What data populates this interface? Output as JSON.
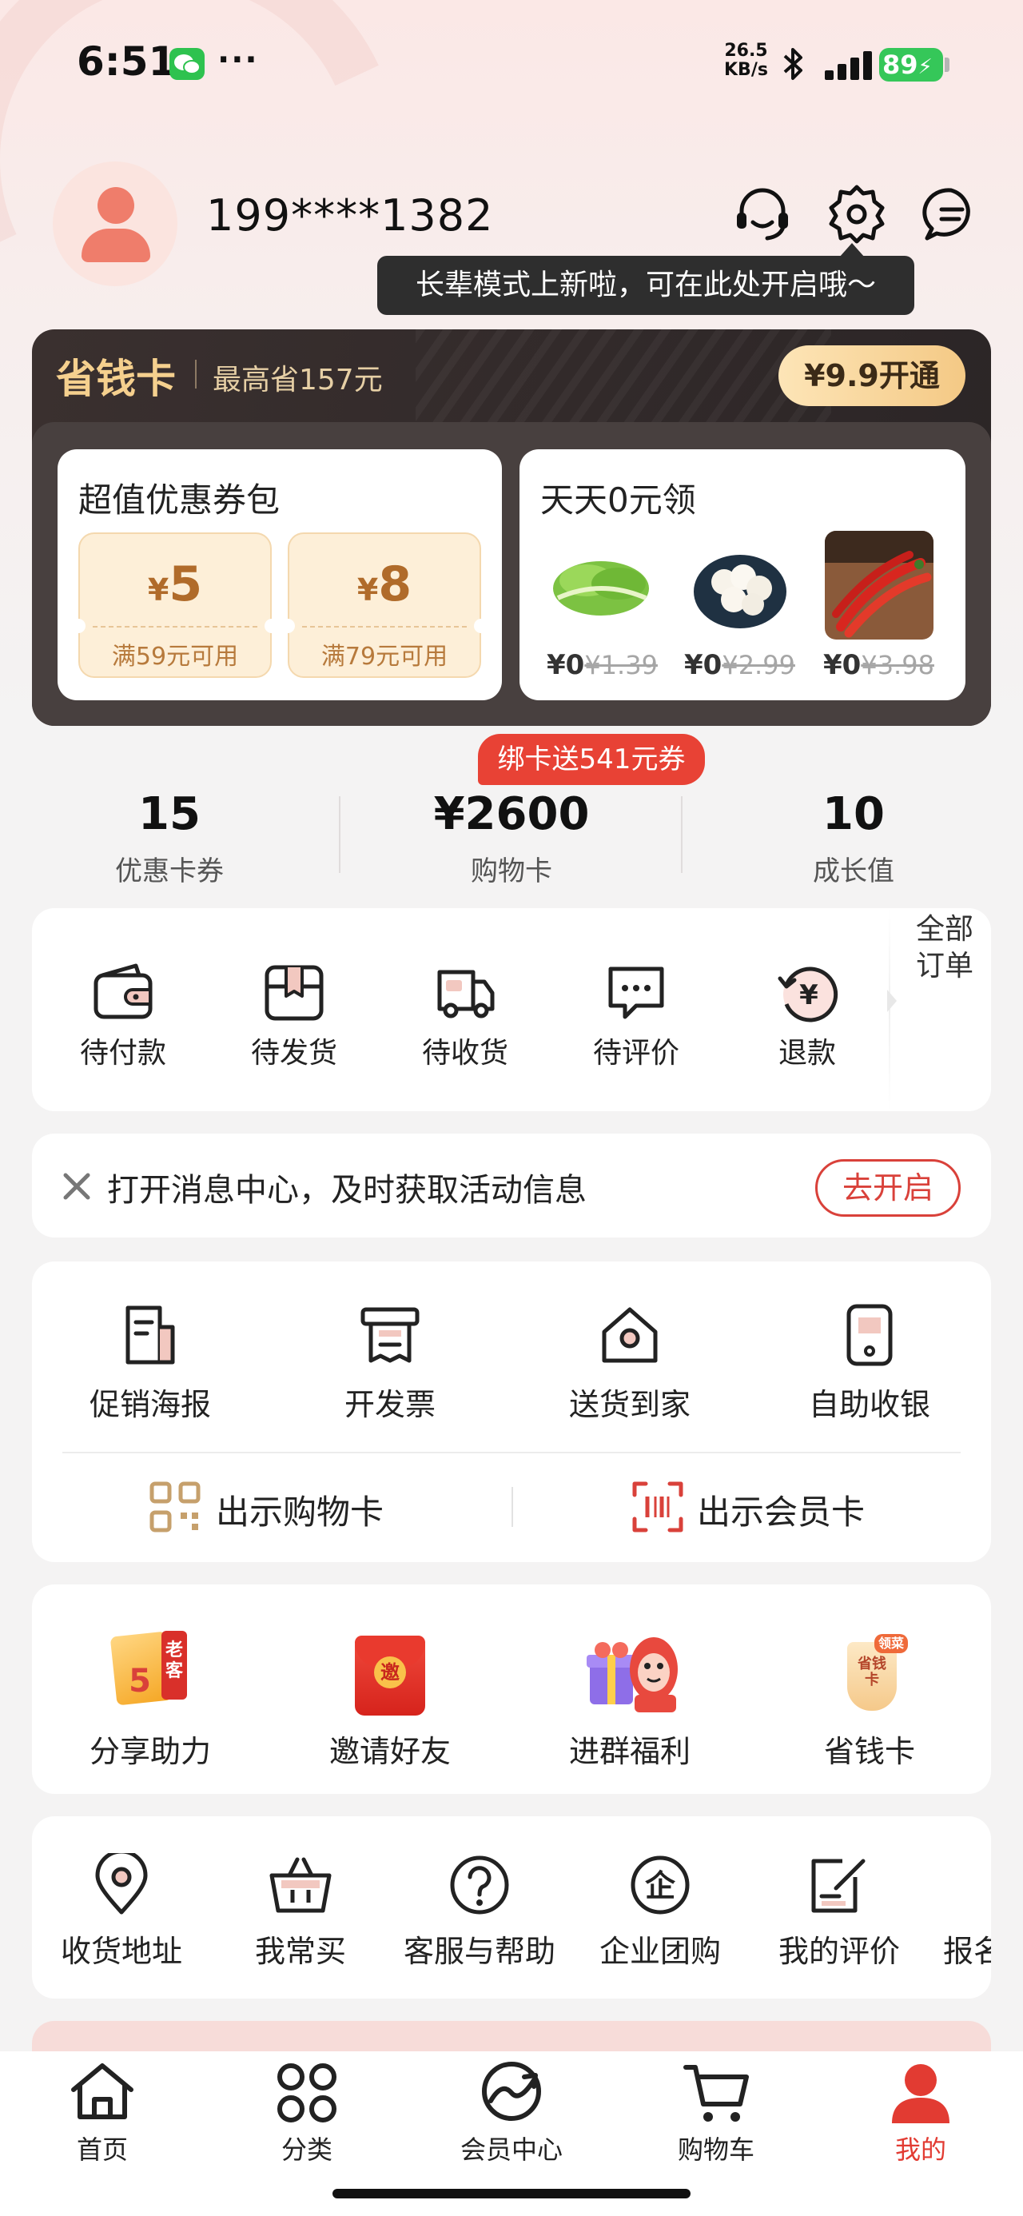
{
  "status_bar": {
    "time": "6:51",
    "dots": "···",
    "net_speed_value": "26.5",
    "net_speed_unit": "KB/s",
    "battery": "89"
  },
  "profile": {
    "phone": "199****1382",
    "tooltip": "长辈模式上新啦，可在此处开启哦～"
  },
  "savings_card": {
    "title": "省钱卡",
    "subtitle": "最高省157元",
    "open_button": "¥9.9开通",
    "coupon_pack": {
      "title": "超值优惠券包",
      "coupons": [
        {
          "symbol": "¥",
          "amount": "5",
          "condition": "满59元可用"
        },
        {
          "symbol": "¥",
          "amount": "8",
          "condition": "满79元可用"
        }
      ]
    },
    "daily_free": {
      "title": "天天0元领",
      "items": [
        {
          "price": "¥0",
          "original": "¥1.39",
          "image": "lettuce"
        },
        {
          "price": "¥0",
          "original": "¥2.99",
          "image": "garlic"
        },
        {
          "price": "¥0",
          "original": "¥3.98",
          "image": "chili-peppers"
        }
      ]
    }
  },
  "stats": {
    "promo_badge": "绑卡送541元券",
    "items": [
      {
        "value": "15",
        "label": "优惠卡券"
      },
      {
        "value": "¥2600",
        "label": "购物卡"
      },
      {
        "value": "10",
        "label": "成长值"
      }
    ]
  },
  "orders": {
    "items": [
      {
        "label": "待付款",
        "icon": "wallet-icon"
      },
      {
        "label": "待发货",
        "icon": "box-icon"
      },
      {
        "label": "待收货",
        "icon": "truck-icon"
      },
      {
        "label": "待评价",
        "icon": "chat-icon"
      },
      {
        "label": "退款",
        "icon": "refund-icon"
      }
    ],
    "all_orders": "全部订单"
  },
  "notice": {
    "text": "打开消息中心，及时获取活动信息",
    "button": "去开启"
  },
  "tools": {
    "items": [
      {
        "label": "促销海报",
        "icon": "poster-icon"
      },
      {
        "label": "开发票",
        "icon": "invoice-icon"
      },
      {
        "label": "送货到家",
        "icon": "home-delivery-icon"
      },
      {
        "label": "自助收银",
        "icon": "self-checkout-icon"
      }
    ],
    "show_shopping_card": "出示购物卡",
    "show_member_card": "出示会员卡"
  },
  "promos": {
    "items": [
      {
        "label": "分享助力",
        "icon": "share-boost-icon"
      },
      {
        "label": "邀请好友",
        "icon": "invite-envelope-icon"
      },
      {
        "label": "进群福利",
        "icon": "group-gift-icon"
      },
      {
        "label": "省钱卡",
        "icon": "savings-card-icon"
      }
    ],
    "share_badge_text": "老客",
    "share_coupon_text": "5",
    "invite_stamp": "邀",
    "savings_tag": "领菜",
    "savings_card_text": "省钱卡"
  },
  "services": {
    "items": [
      {
        "label": "收货地址",
        "icon": "location-pin-icon"
      },
      {
        "label": "我常买",
        "icon": "basket-icon"
      },
      {
        "label": "客服与帮助",
        "icon": "help-icon"
      },
      {
        "label": "企业团购",
        "icon": "enterprise-icon"
      },
      {
        "label": "我的评价",
        "icon": "review-icon"
      },
      {
        "label": "报名",
        "icon": "signup-icon"
      }
    ]
  },
  "tab_bar": {
    "items": [
      {
        "label": "首页",
        "icon": "home-icon"
      },
      {
        "label": "分类",
        "icon": "category-icon"
      },
      {
        "label": "会员中心",
        "icon": "member-center-icon"
      },
      {
        "label": "购物车",
        "icon": "cart-icon"
      },
      {
        "label": "我的",
        "icon": "profile-icon"
      }
    ],
    "active_color": "#e23b32"
  },
  "colors": {
    "accent_red": "#e23b32",
    "gold": "#f5d08e"
  }
}
